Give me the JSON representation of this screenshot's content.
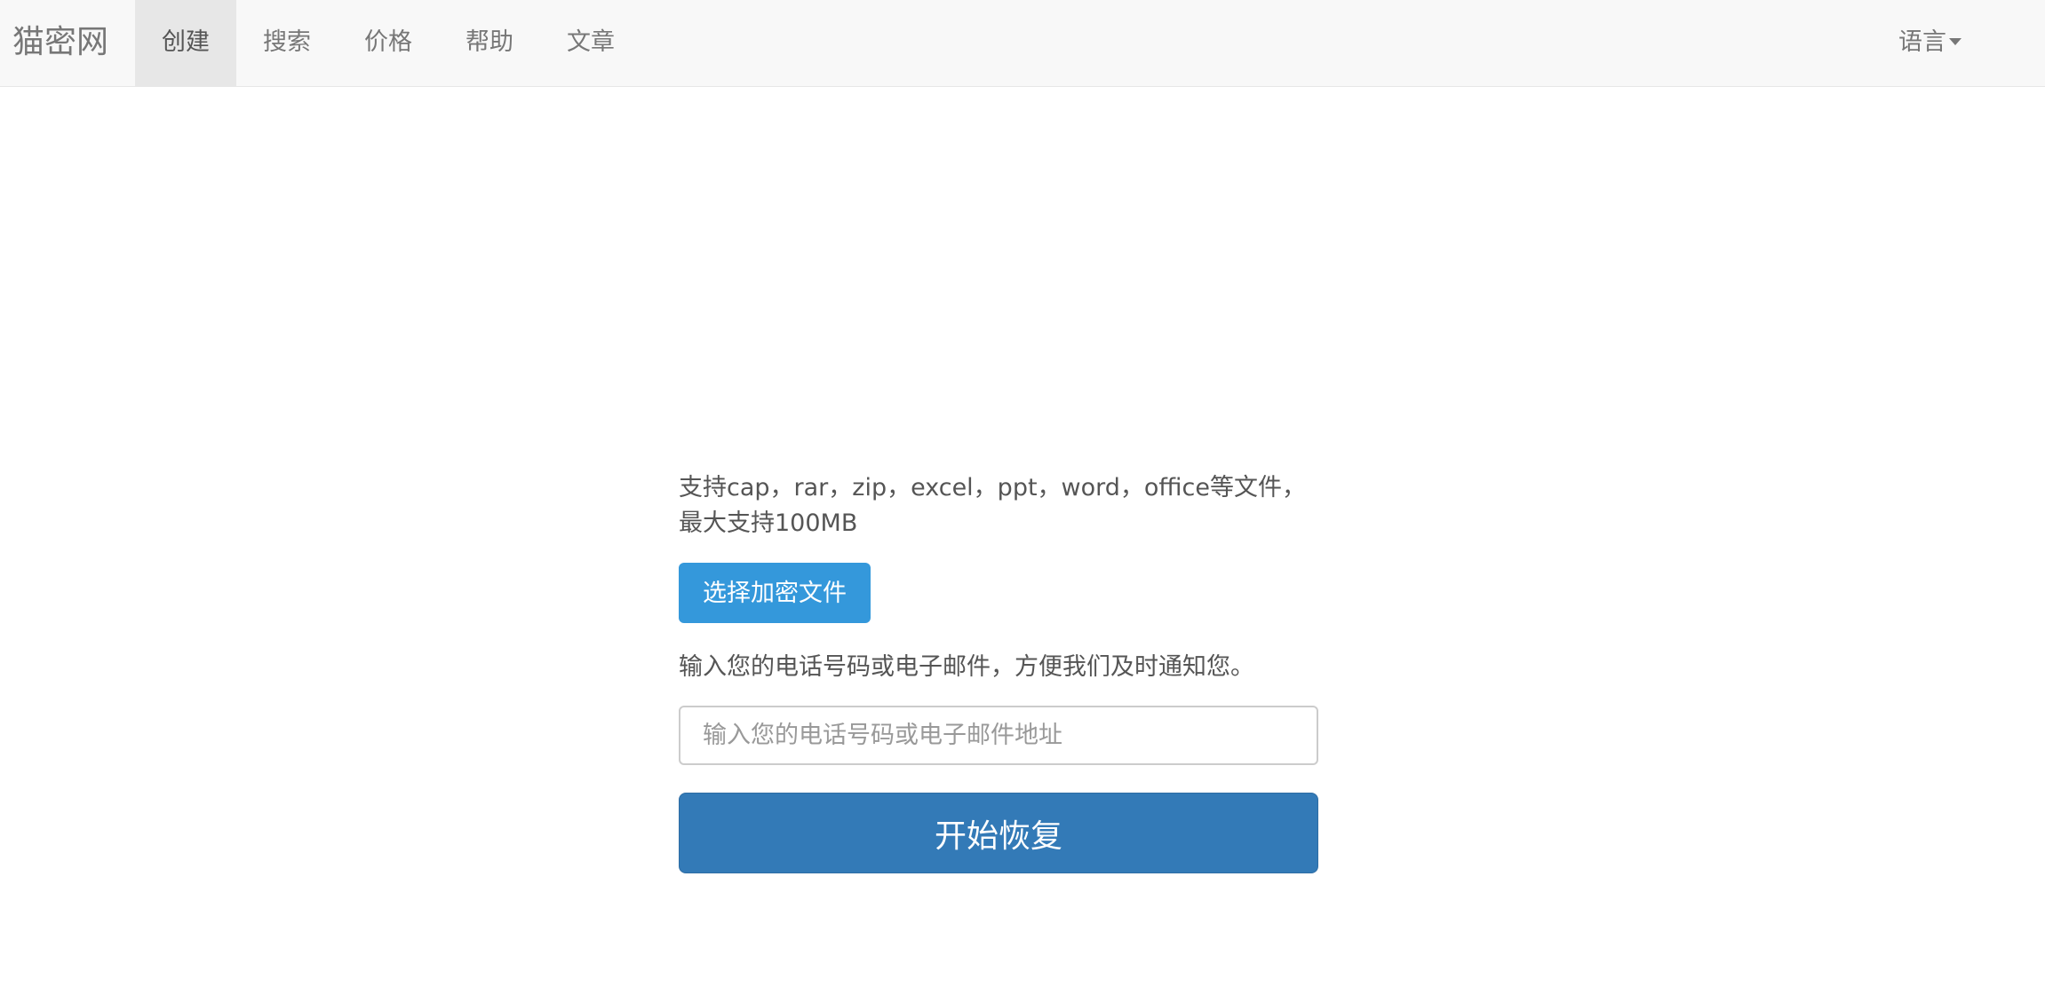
{
  "navbar": {
    "brand": "猫密网",
    "items": [
      {
        "label": "创建",
        "active": true
      },
      {
        "label": "搜索",
        "active": false
      },
      {
        "label": "价格",
        "active": false
      },
      {
        "label": "帮助",
        "active": false
      },
      {
        "label": "文章",
        "active": false
      }
    ],
    "language_label": "语言"
  },
  "upload": {
    "support_text": "支持cap，rar，zip，excel，ppt，word，office等文件，最大支持100MB",
    "choose_button_label": "选择加密文件",
    "button_color": "#3498db"
  },
  "contact": {
    "hint": "输入您的电话号码或电子邮件，方便我们及时通知您。",
    "placeholder": "输入您的电话号码或电子邮件地址",
    "value": ""
  },
  "start_button": {
    "label": "开始恢复",
    "color": "#337ab7"
  }
}
